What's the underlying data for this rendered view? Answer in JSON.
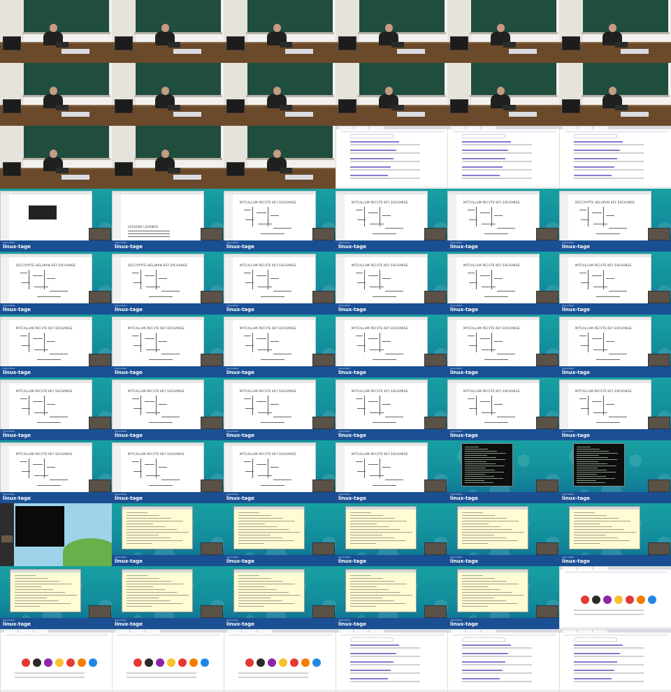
{
  "sheet": {
    "columns": 6,
    "rows": 11,
    "tile_count": 66
  },
  "colors": {
    "chalkboard": "#1f4d3e",
    "desk": "#6b4a2b",
    "desktop_teal": "#17a0a2",
    "banner_blue": "#1b4f93",
    "notes_yellow": "#fffbd3",
    "terminal_black": "#0e0e0e"
  },
  "tile_types": [
    "room",
    "room",
    "room",
    "room",
    "room",
    "room",
    "room",
    "room",
    "room",
    "room",
    "room",
    "room",
    "room",
    "room",
    "room",
    "web",
    "web",
    "web",
    "slide-doc",
    "slide-lessons",
    "slide-exchange",
    "slide-exchange",
    "slide-exchange",
    "slide-exchange",
    "slide-exchange",
    "slide-exchange",
    "slide-split",
    "slide-exchange",
    "slide-exchange",
    "slide-exchange",
    "slide-exchange",
    "slide-exchange",
    "slide-exchange",
    "slide-exchange",
    "slide-exchange",
    "slide-exchange",
    "slide-exchange",
    "slide-exchange",
    "slide-exchange",
    "slide-exchange",
    "slide-exchange",
    "slide-exchange",
    "slide-exchange",
    "slide-exchange",
    "slide-exchange",
    "slide-exchange",
    "terminal",
    "terminal",
    "mixed",
    "notes",
    "notes",
    "notes",
    "notes",
    "notes",
    "notes",
    "notes",
    "notes",
    "notes",
    "notes",
    "image-search",
    "image-search",
    "image-search",
    "image-search",
    "web-search",
    "web-search",
    "web-doc"
  ],
  "slides": {
    "lessons_title": "LESSONS LEARNED",
    "exchange_title": "MITCALLUM-PECVTE KEY EXCHANGE",
    "diffie_title": "DECCRYPTE HELLMAN KEY EXCHANGE",
    "banner_logo": "linux-tage",
    "banner_sub": "Chemnitzer"
  },
  "icons": {
    "logo": "linux-tage-logo",
    "terminal": "terminal-window-icon",
    "browser": "browser-window-icon"
  }
}
